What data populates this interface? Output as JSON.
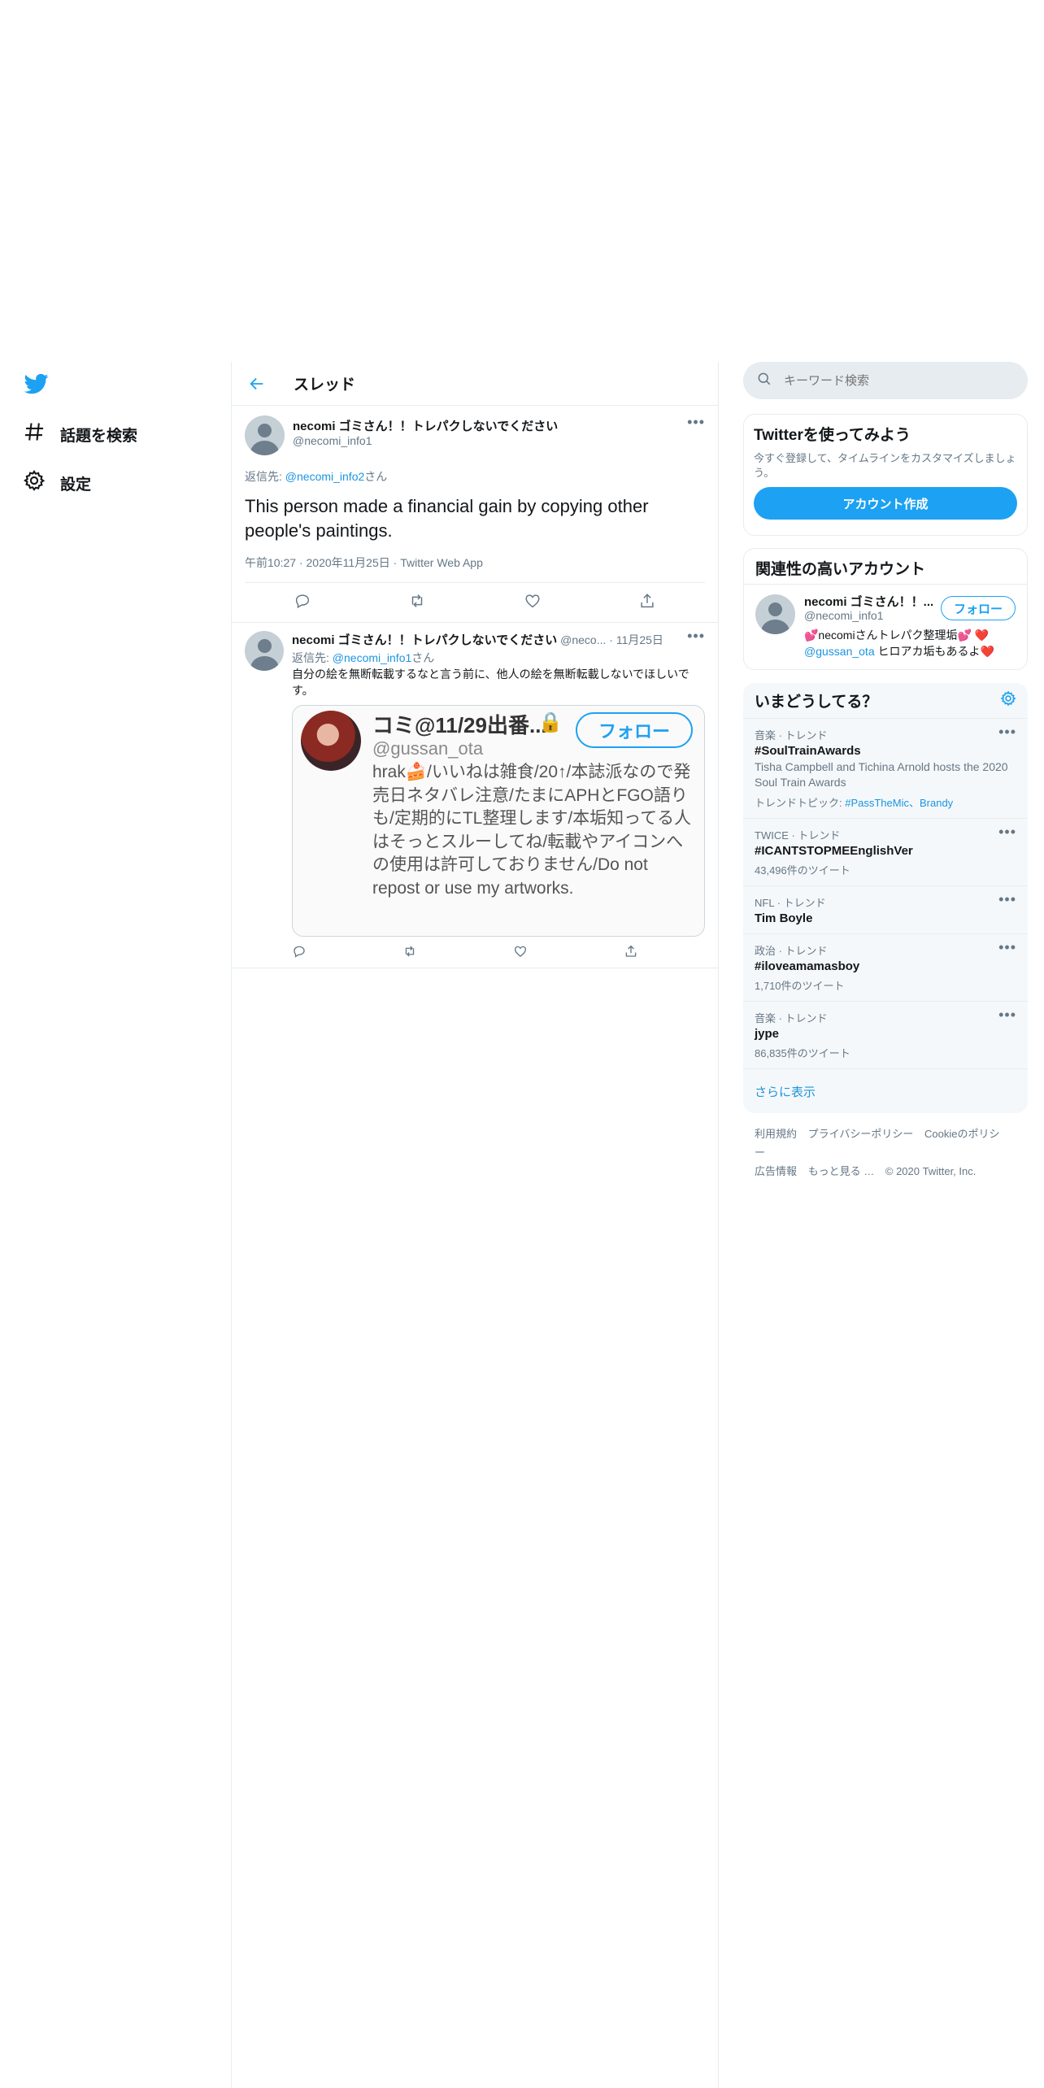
{
  "nav": {
    "explore_label": "話題を検索",
    "settings_label": "設定"
  },
  "header": {
    "title": "スレッド"
  },
  "focused_tweet": {
    "name": "necomi ゴミさん！！トレパクしないでください",
    "handle": "@necomi_info1",
    "replying_prefix": "返信先: ",
    "replying_to": "@necomi_info2",
    "replying_suffix": "さん",
    "text": "This person made a financial gain by copying other people's paintings.",
    "time": "午前10:27",
    "date": "2020年11月25日",
    "source": "Twitter Web App"
  },
  "reply_tweet": {
    "name": "necomi ゴミさん！！トレパクしないでください",
    "handle": "@neco...",
    "date": "11月25日",
    "replying_prefix": "返信先: ",
    "replying_to": "@necomi_info1",
    "replying_suffix": "さん",
    "text": "自分の絵を無断転載するなと言う前に、他人の絵を無断転載しないでほしいです。",
    "embed": {
      "name": "コミ@11/29出番...",
      "handle": "@gussan_ota",
      "follow_label": "フォロー",
      "bio": "hrak🍰/いいねは雑食/20↑/本誌派なので発売日ネタバレ注意/たまにAPHとFGO語りも/定期的にTL整理します/本垢知ってる人はそっとスルーしてね/転載やアイコンへの使用は許可しておりません/Do not repost or use my artworks."
    }
  },
  "search": {
    "placeholder": "キーワード検索"
  },
  "signup": {
    "title": "Twitterを使ってみよう",
    "desc": "今すぐ登録して、タイムラインをカスタマイズしましょう。",
    "button": "アカウント作成"
  },
  "related": {
    "title": "関連性の高いアカウント",
    "name": "necomi ゴミさん！！...",
    "handle": "@necomi_info1",
    "follow_label": "フォロー",
    "bio_prefix": "💕necomiさんトレパク整理垢💕 ❤️",
    "bio_link": "@gussan_ota",
    "bio_suffix": " ヒロアカ垢もあるよ❤️"
  },
  "trends": {
    "title": "いまどうしてる？",
    "items": [
      {
        "context": "音楽 · トレンド",
        "name": "#SoulTrainAwards",
        "desc": "Tisha Campbell and Tichina Arnold hosts the 2020 Soul Train Awards",
        "topic_prefix": "トレンドトピック: ",
        "topic_links": "#PassTheMic、Brandy"
      },
      {
        "context": "TWICE · トレンド",
        "name": "#ICANTSTOPMEEnglishVer",
        "meta": "43,496件のツイート"
      },
      {
        "context": "NFL · トレンド",
        "name": "Tim Boyle"
      },
      {
        "context": "政治 · トレンド",
        "name": "#iloveamamasboy",
        "meta": "1,710件のツイート"
      },
      {
        "context": "音楽 · トレンド",
        "name": "jype",
        "meta": "86,835件のツイート"
      }
    ],
    "show_more": "さらに表示"
  },
  "footer": {
    "terms": "利用規約",
    "privacy": "プライバシーポリシー",
    "cookie": "Cookieのポリシー",
    "ads": "広告情報",
    "more": "もっと見る …",
    "copyright": "© 2020 Twitter, Inc."
  },
  "colors": {
    "accent": "#1da1f2",
    "link": "#1b95e0",
    "secondary_text": "#657786",
    "border": "#e6ecf0"
  },
  "icons": [
    "twitter-bird-icon",
    "hashtag-icon",
    "gear-icon",
    "back-arrow-icon",
    "more-icon",
    "reply-icon",
    "retweet-icon",
    "like-icon",
    "share-icon",
    "search-icon",
    "lock-icon"
  ]
}
